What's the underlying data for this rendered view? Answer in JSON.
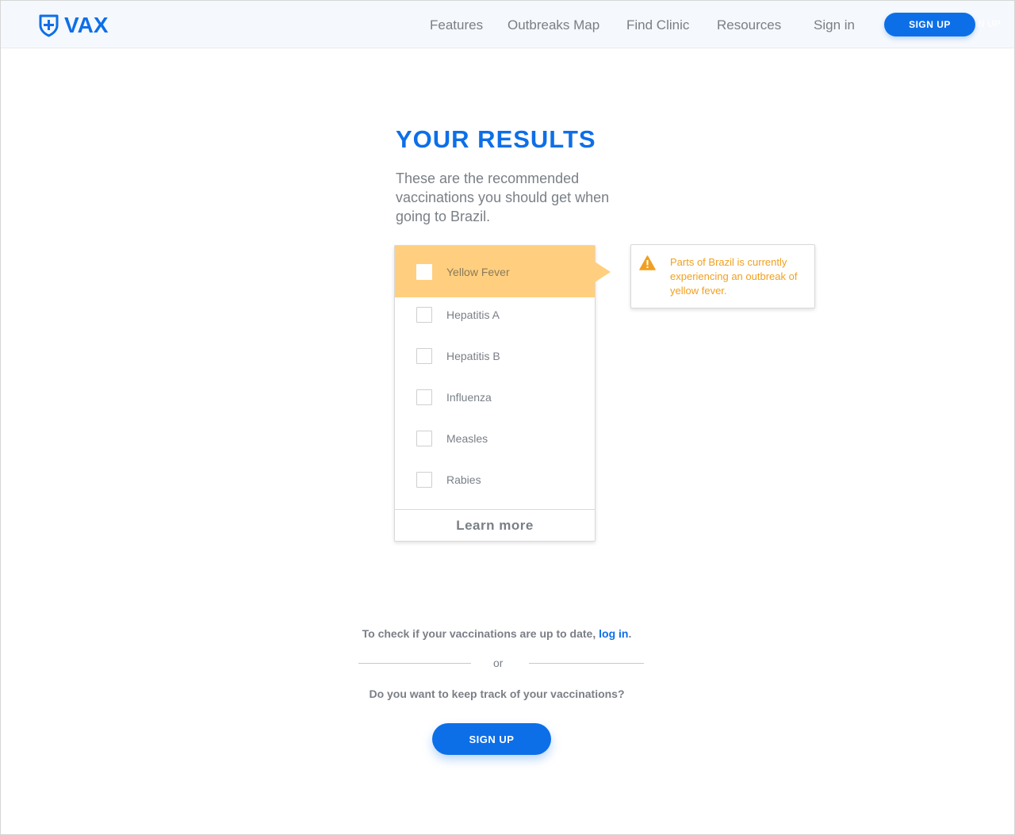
{
  "brand": {
    "name": "VAX",
    "logo_icon": "shield-plus-icon",
    "primary_color": "#0d6fe8"
  },
  "nav": {
    "features": "Features",
    "outbreaks_map": "Outbreaks Map",
    "find_clinic": "Find Clinic",
    "resources": "Resources",
    "sign_in": "Sign in",
    "sign_up": "SIGN UP",
    "ghost_text": "N UP"
  },
  "results": {
    "title": "YOUR RESULTS",
    "description": "These are the recommended vaccinations you should get when going to Brazil.",
    "vaccinations": [
      {
        "label": "Yellow Fever",
        "checked": false,
        "highlighted": true
      },
      {
        "label": "Hepatitis A",
        "checked": false,
        "highlighted": false
      },
      {
        "label": "Hepatitis B",
        "checked": false,
        "highlighted": false
      },
      {
        "label": "Influenza",
        "checked": false,
        "highlighted": false
      },
      {
        "label": "Measles",
        "checked": false,
        "highlighted": false
      },
      {
        "label": "Rabies",
        "checked": false,
        "highlighted": false
      }
    ],
    "learn_more": "Learn more",
    "highlight_color": "#ffcf7f"
  },
  "alert": {
    "icon": "warning-icon",
    "text": "Parts of Brazil is currently experiencing an outbreak of yellow fever.",
    "color": "#f0a020"
  },
  "footer_cta": {
    "login_prefix": "To check if your vaccinations are up to date, ",
    "login_link": "log in",
    "login_suffix": ".",
    "or": "or",
    "track_question": "Do you want to keep track of your vaccinations?",
    "sign_up": "SIGN UP"
  }
}
